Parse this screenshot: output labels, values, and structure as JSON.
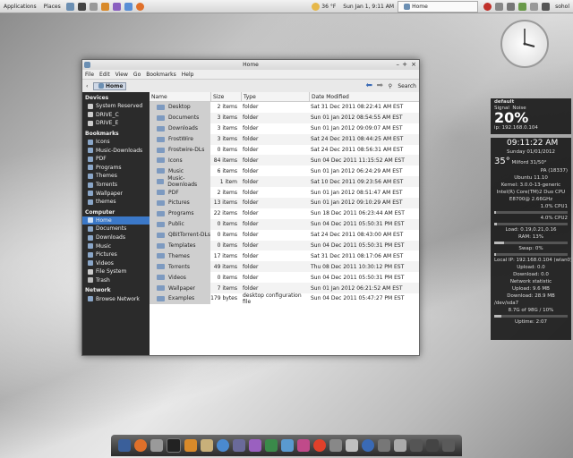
{
  "panel": {
    "applications": "Applications",
    "places": "Places",
    "weather": "36 °F",
    "datetime": "Sun Jan 1, 9:11 AM",
    "task_home": "Home",
    "user": "sohol"
  },
  "window": {
    "title": "Home",
    "menu": [
      "File",
      "Edit",
      "View",
      "Go",
      "Bookmarks",
      "Help"
    ],
    "crumb": "Home",
    "search": "Search"
  },
  "sidebar": {
    "devices_header": "Devices",
    "devices": [
      "System Reserved",
      "DRIVE_C",
      "DRIVE_E"
    ],
    "bookmarks_header": "Bookmarks",
    "bookmarks": [
      "Icons",
      "Music-Downloads",
      "PDF",
      "Programs",
      "Themes",
      "Torrents",
      "Wallpaper",
      "themes"
    ],
    "computer_header": "Computer",
    "computer": [
      "Home",
      "Documents",
      "Downloads",
      "Music",
      "Pictures",
      "Videos",
      "File System",
      "Trash"
    ],
    "network_header": "Network",
    "network": [
      "Browse Network"
    ]
  },
  "columns": {
    "name": "Name",
    "size": "Size",
    "type": "Type",
    "date": "Date Modified"
  },
  "files": [
    {
      "name": "Desktop",
      "size": "2 items",
      "type": "folder",
      "date": "Sat 31 Dec 2011 08:22:41 AM EST"
    },
    {
      "name": "Documents",
      "size": "3 items",
      "type": "folder",
      "date": "Sun 01 Jan 2012 08:54:55 AM EST"
    },
    {
      "name": "Downloads",
      "size": "3 items",
      "type": "folder",
      "date": "Sun 01 Jan 2012 09:09:07 AM EST"
    },
    {
      "name": "FrostWire",
      "size": "3 items",
      "type": "folder",
      "date": "Sat 24 Dec 2011 08:44:25 AM EST"
    },
    {
      "name": "Frostwire-DLs",
      "size": "0 items",
      "type": "folder",
      "date": "Sat 24 Dec 2011 08:56:31 AM EST"
    },
    {
      "name": "Icons",
      "size": "84 items",
      "type": "folder",
      "date": "Sun 04 Dec 2011 11:15:52 AM EST"
    },
    {
      "name": "Music",
      "size": "6 items",
      "type": "folder",
      "date": "Sun 01 Jan 2012 06:24:29 AM EST"
    },
    {
      "name": "Music-Downloads",
      "size": "1 item",
      "type": "folder",
      "date": "Sat 10 Dec 2011 09:23:56 AM EST"
    },
    {
      "name": "PDF",
      "size": "2 items",
      "type": "folder",
      "date": "Sun 01 Jan 2012 08:51:47 AM EST"
    },
    {
      "name": "Pictures",
      "size": "13 items",
      "type": "folder",
      "date": "Sun 01 Jan 2012 09:10:29 AM EST"
    },
    {
      "name": "Programs",
      "size": "22 items",
      "type": "folder",
      "date": "Sun 18 Dec 2011 06:23:44 AM EST"
    },
    {
      "name": "Public",
      "size": "0 items",
      "type": "folder",
      "date": "Sun 04 Dec 2011 05:50:31 PM EST"
    },
    {
      "name": "QBitTorrent-DLs",
      "size": "0 items",
      "type": "folder",
      "date": "Sat 24 Dec 2011 08:43:00 AM EST"
    },
    {
      "name": "Templates",
      "size": "0 items",
      "type": "folder",
      "date": "Sun 04 Dec 2011 05:50:31 PM EST"
    },
    {
      "name": "Themes",
      "size": "17 items",
      "type": "folder",
      "date": "Sat 31 Dec 2011 08:17:06 AM EST"
    },
    {
      "name": "Torrents",
      "size": "49 items",
      "type": "folder",
      "date": "Thu 08 Dec 2011 10:30:12 PM EST"
    },
    {
      "name": "Videos",
      "size": "0 items",
      "type": "folder",
      "date": "Sun 04 Dec 2011 05:50:31 PM EST"
    },
    {
      "name": "Wallpaper",
      "size": "7 items",
      "type": "folder",
      "date": "Sun 01 Jan 2012 06:21:52 AM EST"
    },
    {
      "name": "Examples",
      "size": "179 bytes",
      "type": "desktop configuration file",
      "date": "Sun 04 Dec 2011 05:47:27 PM EST"
    }
  ],
  "wifi": {
    "name": "default",
    "signal_label": "Signal",
    "noise_label": "Noise",
    "pct": "20%",
    "ip": "ip: 192.168.0.104"
  },
  "sysinfo": {
    "time": "09:11:22 AM",
    "date": "Sunday 01/01/2012",
    "temp": "35°",
    "location": "Milford 31/50°",
    "location2": "PA (18337)",
    "distro": "Ubuntu 11.10",
    "kernel": "Kernel: 3.0.0-13-generic",
    "cpu": "Intel(R) Core(TM)2 Duo CPU",
    "cpu2": "E8700@ 2.66GHz",
    "cpu1": "1.0% CPU1",
    "cpu2load": "4.0% CPU2",
    "load": "Load: 0.19,0.21,0.16",
    "ram": "RAM: 13%",
    "swap": "Swap: 0%",
    "localip": "Local IP: 192.168.0.104 (wlan0)",
    "upload": "Upload: 0.0",
    "download": "Download: 0.0",
    "netstat": "Network statistic",
    "uptotal": "Upload: 9.6 MB",
    "downtotal": "Download: 28.9 MB",
    "disk": "/dev/sda7",
    "disk_usage": "8.7G of 98G / 10%",
    "uptime": "Uptime: 2:07",
    "cpu1_pct": 0.01,
    "cpu2_pct": 0.04,
    "ram_pct": 0.13,
    "swap_pct": 0.0,
    "disk_pct": 0.1
  }
}
